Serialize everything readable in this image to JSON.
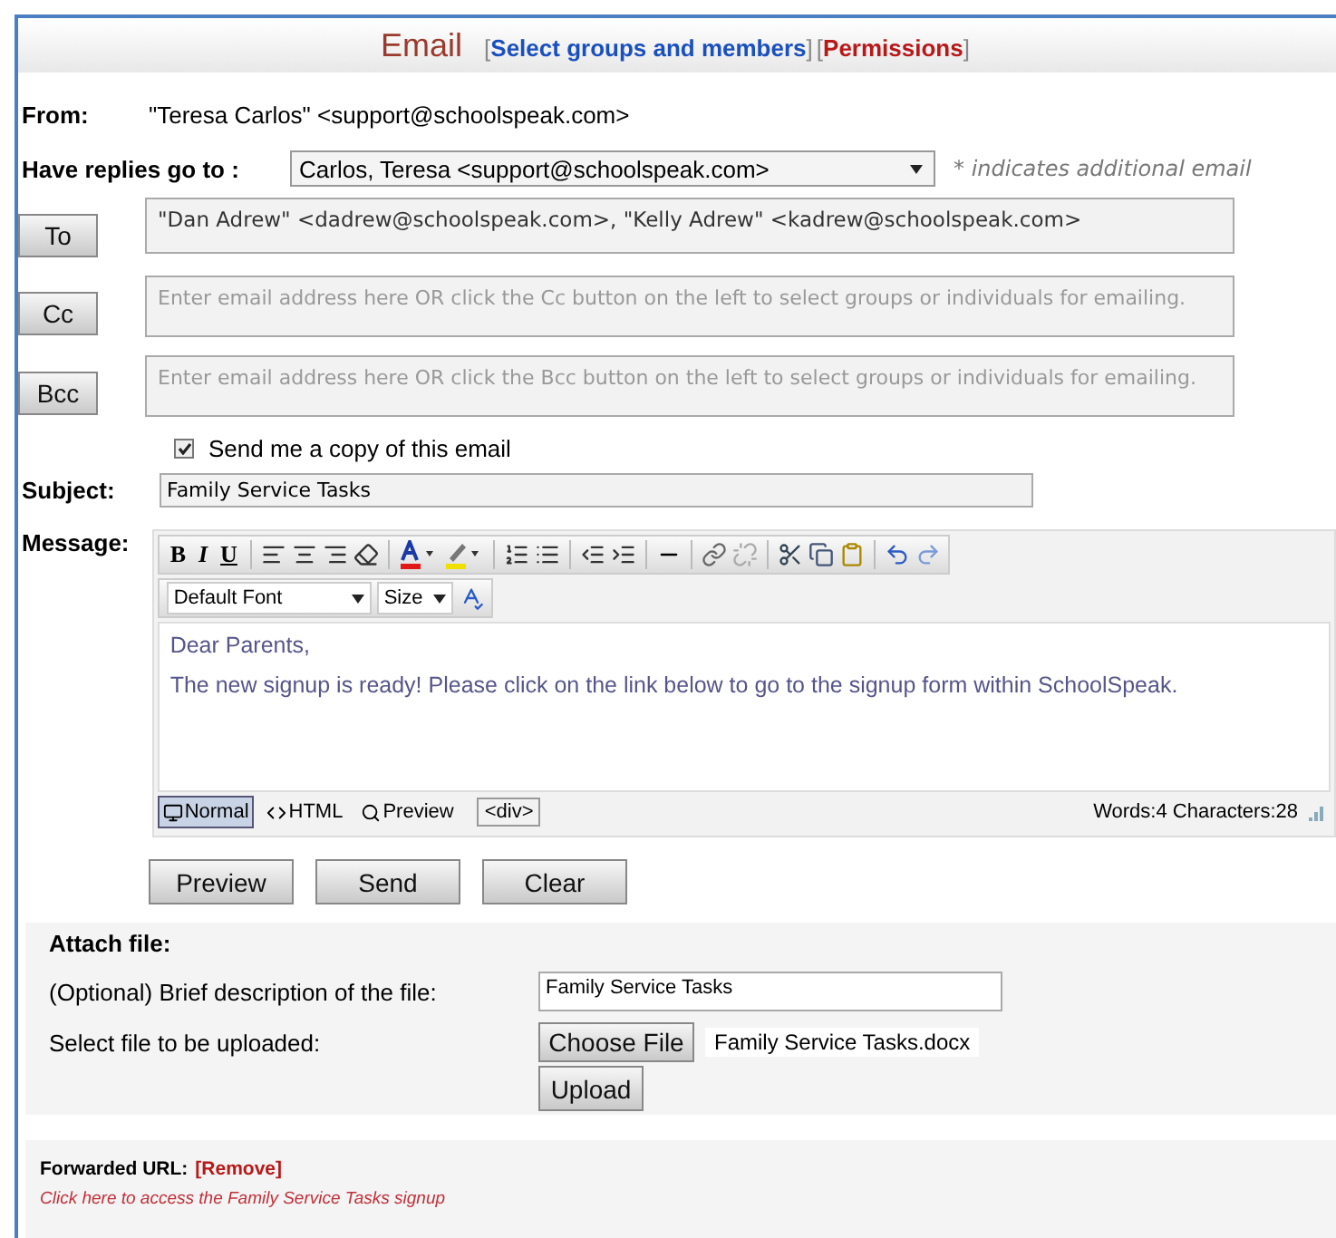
{
  "header": {
    "title": "Email",
    "links": [
      {
        "open": "[",
        "label": "Select groups and members",
        "close": "]",
        "kind": "primary"
      },
      {
        "open": "[",
        "label": "Permissions",
        "close": "]",
        "kind": "danger"
      }
    ]
  },
  "from": {
    "label": "From:",
    "value": "\"Teresa Carlos\" <support@schoolspeak.com>"
  },
  "reply_to": {
    "label": "Have replies go to :",
    "value": "Carlos, Teresa <support@schoolspeak.com>",
    "note": "* indicates additional email"
  },
  "recipients": [
    {
      "button": "To",
      "value": "\"Dan Adrew\" <dadrew@schoolspeak.com>, \"Kelly Adrew\" <kadrew@schoolspeak.com>"
    },
    {
      "button": "Cc",
      "placeholder": "Enter email address here OR click the Cc button on the left to select groups or individuals for emailing."
    },
    {
      "button": "Bcc",
      "placeholder": "Enter email address here OR click the Bcc button on the left to select groups or individuals for emailing."
    }
  ],
  "send_copy": {
    "label": "Send me a copy of this email",
    "checked": true
  },
  "subject": {
    "label": "Subject:",
    "value": "Family Service Tasks"
  },
  "message": {
    "label": "Message:",
    "format_letters": [
      "B",
      "I",
      "U"
    ],
    "font": "Default Font",
    "size": "Size",
    "body": [
      "Dear Parents,",
      "The new signup is ready! Please click on the link below to go to the signup form within SchoolSpeak."
    ],
    "modes": [
      {
        "label": "Normal",
        "selected": true
      },
      {
        "label": "HTML",
        "selected": false
      },
      {
        "label": "Preview",
        "selected": false
      }
    ],
    "tag": "<div>",
    "counts": "Words:4 Characters:28"
  },
  "actions": [
    "Preview",
    "Send",
    "Clear"
  ],
  "attach": {
    "title": "Attach file:",
    "description_label": "(Optional) Brief description of the file:",
    "description": "Family Service Tasks",
    "file_label": "Select file to be uploaded:",
    "choose": "Choose File",
    "file_name": "Family Service Tasks.docx",
    "upload": "Upload"
  },
  "forwarded": {
    "label": "Forwarded URL:",
    "remove": "[Remove]",
    "link": "Click here to access the Family Service Tasks signup"
  }
}
